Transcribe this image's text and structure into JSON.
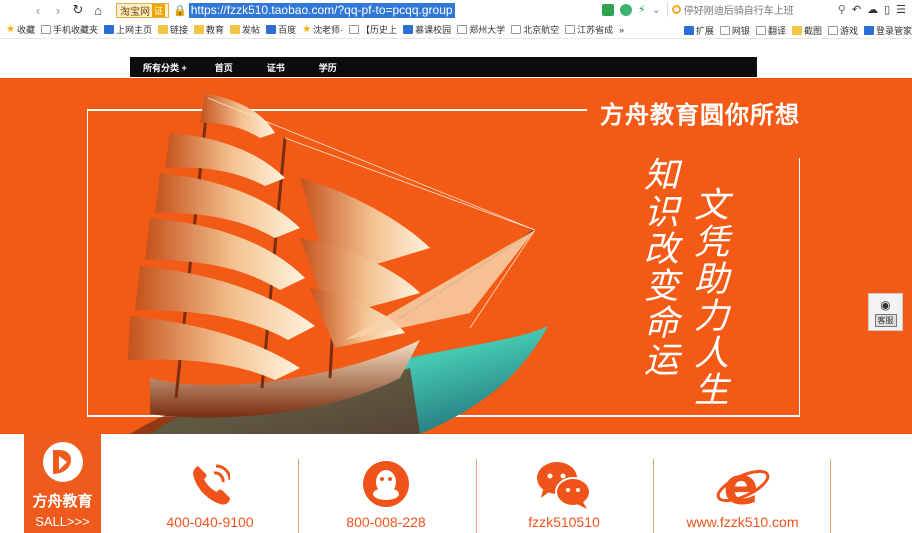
{
  "browser": {
    "site_chip": "淘宝网",
    "site_cert": "证",
    "url": "https://fzzk510.taobao.com/?qq-pf-to=pcqq.group",
    "search_placeholder": "停好刚迪后骑自行车上班"
  },
  "bookmarks": {
    "left": [
      {
        "label": "收藏",
        "icon": "star"
      },
      {
        "label": "手机收藏夹",
        "icon": "page"
      },
      {
        "label": "上网主页",
        "icon": "blue"
      },
      {
        "label": "链接",
        "icon": "folder"
      },
      {
        "label": "教育",
        "icon": "folder"
      },
      {
        "label": "发帖",
        "icon": "folder"
      },
      {
        "label": "百度",
        "icon": "blue"
      },
      {
        "label": "沈老师·",
        "icon": "star"
      },
      {
        "label": "【历史上",
        "icon": "page"
      },
      {
        "label": "慕课校园",
        "icon": "blue"
      },
      {
        "label": "郑州大学",
        "icon": "page"
      },
      {
        "label": "北京航空",
        "icon": "page"
      },
      {
        "label": "江苏省成",
        "icon": "page"
      },
      {
        "label": "»",
        "icon": "none"
      }
    ],
    "right": [
      {
        "label": "扩展",
        "icon": "blue"
      },
      {
        "label": "网银",
        "icon": "page"
      },
      {
        "label": "翻译",
        "icon": "page"
      },
      {
        "label": "截图",
        "icon": "folder"
      },
      {
        "label": "游戏",
        "icon": "page"
      },
      {
        "label": "登录管家",
        "icon": "blue"
      }
    ]
  },
  "nav": {
    "items": [
      "所有分类 +",
      "首页",
      "证书",
      "学历"
    ]
  },
  "banner": {
    "headline": "方舟教育圆你所想",
    "vertical_left": "知识改变命运",
    "vertical_right": "文凭助力人生"
  },
  "widget": {
    "button": "客服"
  },
  "contact": {
    "brand_name": "方舟教育",
    "brand_sub": "SALL>>>",
    "items": [
      {
        "label": "400-040-9100",
        "icon": "phone-icon"
      },
      {
        "label": "800-008-228",
        "icon": "qq-icon"
      },
      {
        "label": "fzzk510510",
        "icon": "wechat-icon"
      },
      {
        "label": "www.fzzk510.com",
        "icon": "ie-icon"
      }
    ]
  },
  "colors": {
    "accent_orange": "#f25a16",
    "nav_bg": "#0c0c0c",
    "url_highlight": "#3178d6"
  }
}
